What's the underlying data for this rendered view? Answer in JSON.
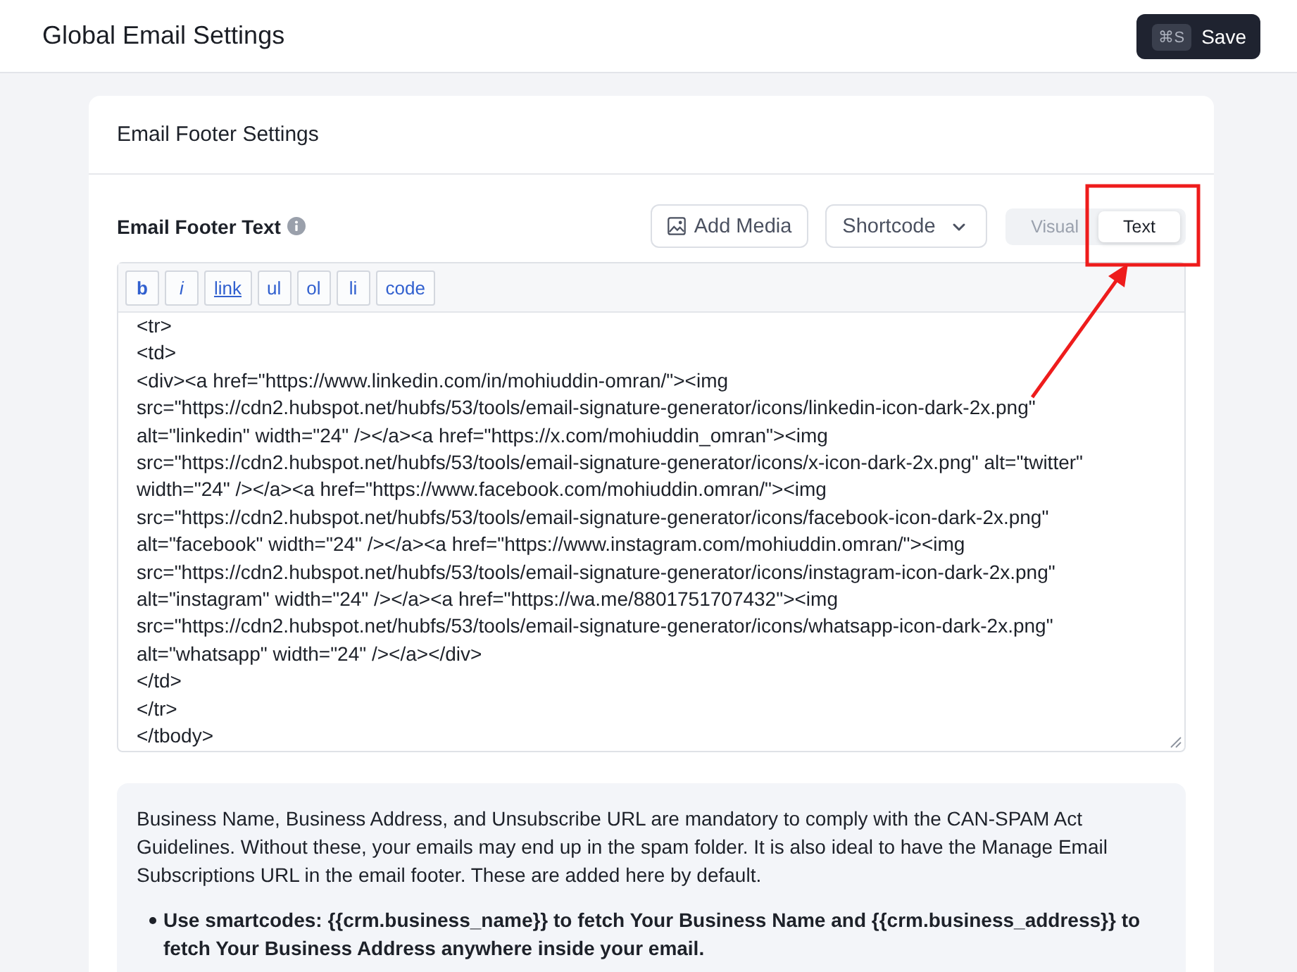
{
  "header": {
    "title": "Global Email Settings",
    "save_button": {
      "shortcut": "⌘S",
      "label": "Save"
    }
  },
  "card": {
    "title": "Email Footer Settings",
    "field": {
      "label": "Email Footer Text",
      "add_media": "Add Media",
      "shortcode": "Shortcode",
      "modes": [
        {
          "label": "Visual",
          "selected": false
        },
        {
          "label": "Text",
          "selected": true
        }
      ]
    },
    "toolbar": [
      {
        "label": "b",
        "kind": "bold"
      },
      {
        "label": "i",
        "kind": "italic"
      },
      {
        "label": "link",
        "kind": "link"
      },
      {
        "label": "ul",
        "kind": "plain"
      },
      {
        "label": "ol",
        "kind": "plain"
      },
      {
        "label": "li",
        "kind": "plain"
      },
      {
        "label": "code",
        "kind": "plain"
      }
    ],
    "editor": {
      "lines": [
        "<tr>",
        "<td>",
        "<div><a href=\"https://www.linkedin.com/in/mohiuddin-omran/\"><img",
        "src=\"https://cdn2.hubspot.net/hubfs/53/tools/email-signature-generator/icons/linkedin-icon-dark-2x.png\"",
        "alt=\"linkedin\" width=\"24\" /></a><a href=\"https://x.com/mohiuddin_omran\"><img",
        "src=\"https://cdn2.hubspot.net/hubfs/53/tools/email-signature-generator/icons/x-icon-dark-2x.png\" alt=\"twitter\"",
        "width=\"24\" /></a><a href=\"https://www.facebook.com/mohiuddin.omran/\"><img",
        "src=\"https://cdn2.hubspot.net/hubfs/53/tools/email-signature-generator/icons/facebook-icon-dark-2x.png\"",
        "alt=\"facebook\" width=\"24\" /></a><a href=\"https://www.instagram.com/mohiuddin.omran/\"><img",
        "src=\"https://cdn2.hubspot.net/hubfs/53/tools/email-signature-generator/icons/instagram-icon-dark-2x.png\"",
        "alt=\"instagram\" width=\"24\" /></a><a href=\"https://wa.me/8801751707432\"><img",
        "src=\"https://cdn2.hubspot.net/hubfs/53/tools/email-signature-generator/icons/whatsapp-icon-dark-2x.png\"",
        "alt=\"whatsapp\" width=\"24\" /></a></div>",
        "</td>",
        "</tr>",
        "</tbody>"
      ]
    },
    "notice": {
      "text": "Business Name, Business Address, and Unsubscribe URL are mandatory to comply with the CAN-SPAM Act Guidelines. Without these, your emails may end up in the spam folder. It is also ideal to have the Manage Email Subscriptions URL in the email footer. These are added here by default.",
      "bullets": [
        "Use smartcodes: {{crm.business_name}} to fetch Your Business Name and {{crm.business_address}} to fetch Your Business Address anywhere inside your email."
      ]
    }
  }
}
